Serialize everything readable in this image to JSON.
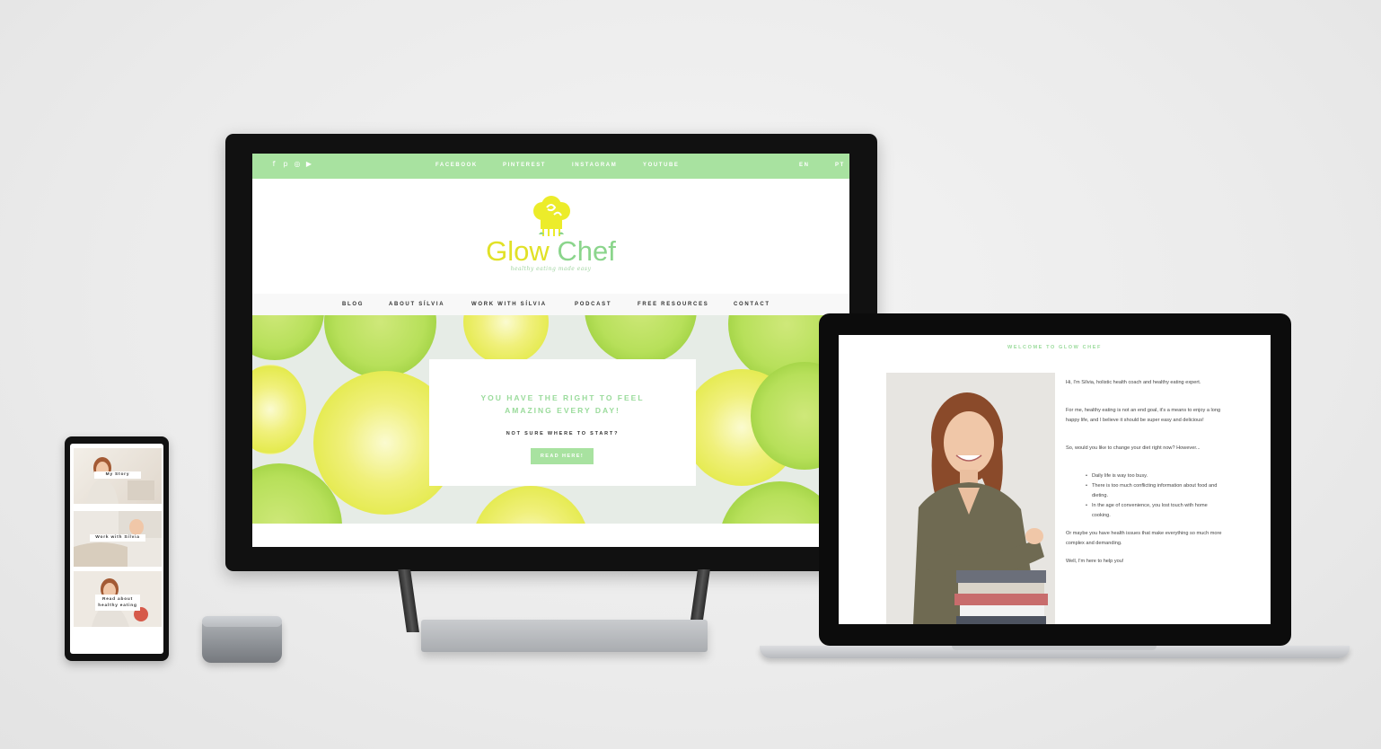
{
  "desktop": {
    "social_icons": [
      "facebook-icon",
      "pinterest-icon",
      "instagram-icon",
      "youtube-icon"
    ],
    "top_links": [
      "FACEBOOK",
      "PINTEREST",
      "INSTAGRAM",
      "YOUTUBE"
    ],
    "languages": [
      "EN",
      "PT"
    ],
    "logo": {
      "word1": "Glow",
      "word2": "Chef",
      "tagline": "healthy eating made easy"
    },
    "nav": [
      "BLOG",
      "ABOUT SÍLVIA",
      "WORK WITH SÍLVIA",
      "PODCAST",
      "FREE RESOURCES",
      "CONTACT"
    ],
    "hero": {
      "title_line1": "YOU HAVE THE RIGHT TO FEEL",
      "title_line2": "AMAZING EVERY DAY!",
      "subtitle": "NOT SURE WHERE TO START?",
      "button": "READ HERE!"
    },
    "colors": {
      "accent_green": "#a8e2a0",
      "logo_yellow": "#e1e127",
      "logo_green": "#8bd58c"
    }
  },
  "laptop": {
    "welcome": "WELCOME TO GLOW CHEF",
    "intro": "Hi, I'm Sílvia, holistic health coach and healthy eating expert.",
    "para1": "For me, healthy eating is not an end goal, it's a means to enjoy a long happy life, and I believe it should be super easy and delicious!",
    "para2": "So, would you like to change your diet right now? However...",
    "bullets": [
      "Daily life is way too busy.",
      "There is too much conflicting information about food and dieting.",
      "In the age of convenience, you lost touch with home cooking."
    ],
    "para3": "Or maybe you have health issues that make everything so much more complex and demanding.",
    "para4": "Well, I'm here to help you!"
  },
  "phone": {
    "cards": [
      "My Story",
      "Work with Sílvia",
      "Read about healthy eating"
    ]
  }
}
